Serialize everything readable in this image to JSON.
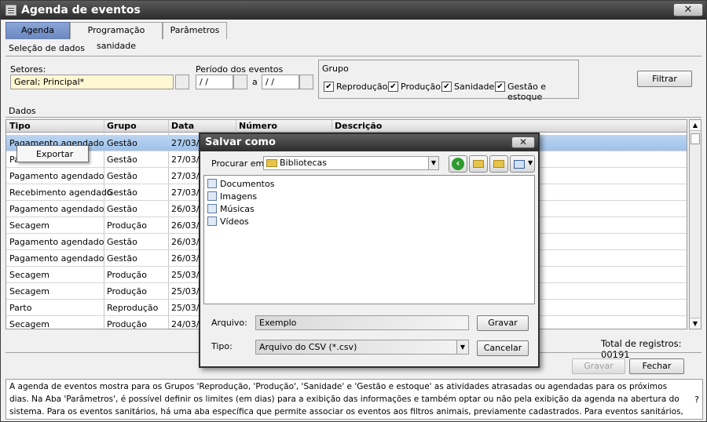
{
  "window": {
    "title": "Agenda de eventos",
    "close_glyph": "✕",
    "icon": "app-list-icon"
  },
  "tabs": [
    {
      "label": "Agenda",
      "active": true
    },
    {
      "label": "Programação sanidade",
      "active": false
    },
    {
      "label": "Parâmetros",
      "active": false
    }
  ],
  "selection": {
    "section_label": "Seleção de dados",
    "setores_label": "Setores:",
    "setores_value": "Geral; Principal*",
    "periodo_label": "Período dos eventos",
    "date_from": " / /",
    "date_sep": "a",
    "date_to": " / /",
    "grupo_label": "Grupo",
    "grupo_options": [
      {
        "label": "Reprodução",
        "checked": true
      },
      {
        "label": "Produção",
        "checked": true
      },
      {
        "label": "Sanidade",
        "checked": true
      },
      {
        "label": "Gestão e estoque",
        "checked": true
      }
    ],
    "filter_button": "Filtrar"
  },
  "grid": {
    "section_label": "Dados",
    "columns": [
      "Tipo",
      "Grupo",
      "Data",
      "Número",
      "Descrição"
    ],
    "rows": [
      {
        "tipo": "Pagamento agendado",
        "grupo": "Gestão",
        "data": "27/03/1",
        "selected": true
      },
      {
        "tipo": "Pa",
        "grupo": "Gestão",
        "data": "27/03/1",
        "selected": false
      },
      {
        "tipo": "Pagamento agendado",
        "grupo": "Gestão",
        "data": "27/03/1",
        "selected": false
      },
      {
        "tipo": "Recebimento agendado",
        "grupo": "Gestão",
        "data": "27/03/1",
        "selected": false
      },
      {
        "tipo": "Pagamento agendado",
        "grupo": "Gestão",
        "data": "26/03/1",
        "selected": false
      },
      {
        "tipo": "Secagem",
        "grupo": "Produção",
        "data": "26/03/1",
        "selected": false
      },
      {
        "tipo": "Pagamento agendado",
        "grupo": "Gestão",
        "data": "26/03/1",
        "selected": false
      },
      {
        "tipo": "Pagamento agendado",
        "grupo": "Gestão",
        "data": "26/03/1",
        "selected": false
      },
      {
        "tipo": "Secagem",
        "grupo": "Produção",
        "data": "25/03/1",
        "selected": false
      },
      {
        "tipo": "Secagem",
        "grupo": "Produção",
        "data": "25/03/1",
        "selected": false
      },
      {
        "tipo": "Parto",
        "grupo": "Reprodução",
        "data": "25/03/1",
        "selected": false
      },
      {
        "tipo": "Secagem",
        "grupo": "Produção",
        "data": "24/03/1",
        "selected": false
      }
    ],
    "total_label": "Total de registros: 00191"
  },
  "context_menu": {
    "items": [
      "Exportar"
    ]
  },
  "dialog": {
    "title": "Salvar como",
    "close_glyph": "✕",
    "lookin_label": "Procurar em :",
    "lookin_value": "Bibliotecas",
    "back_glyph": "‹",
    "items": [
      "Documentos",
      "Imagens",
      "Músicas",
      "Vídeos"
    ],
    "file_label": "Arquivo:",
    "file_value": "Exemplo",
    "type_label": "Tipo:",
    "type_value": "Arquivo do CSV (*.csv)",
    "save_button": "Gravar",
    "cancel_button": "Cancelar"
  },
  "footer": {
    "save_button": "Gravar",
    "close_button": "Fechar"
  },
  "info": {
    "text": "A agenda de eventos mostra para os Grupos 'Reprodução, 'Produção', 'Sanidade' e 'Gestão e estoque' as atividades atrasadas ou agendadas para os próximos dias. Na Aba 'Parâmetros', é possível definir os limites (em dias) para a exibição das informações e também optar ou não pela exibição da agenda na abertura do sistema. Para os eventos sanitários, há uma aba específica que permite associar os eventos aos filtros animais, previamente cadastrados. Para eventos sanitários, você pode obter a listagem de animais relacionados ao filtro escolhido.",
    "help_glyph": "?"
  }
}
